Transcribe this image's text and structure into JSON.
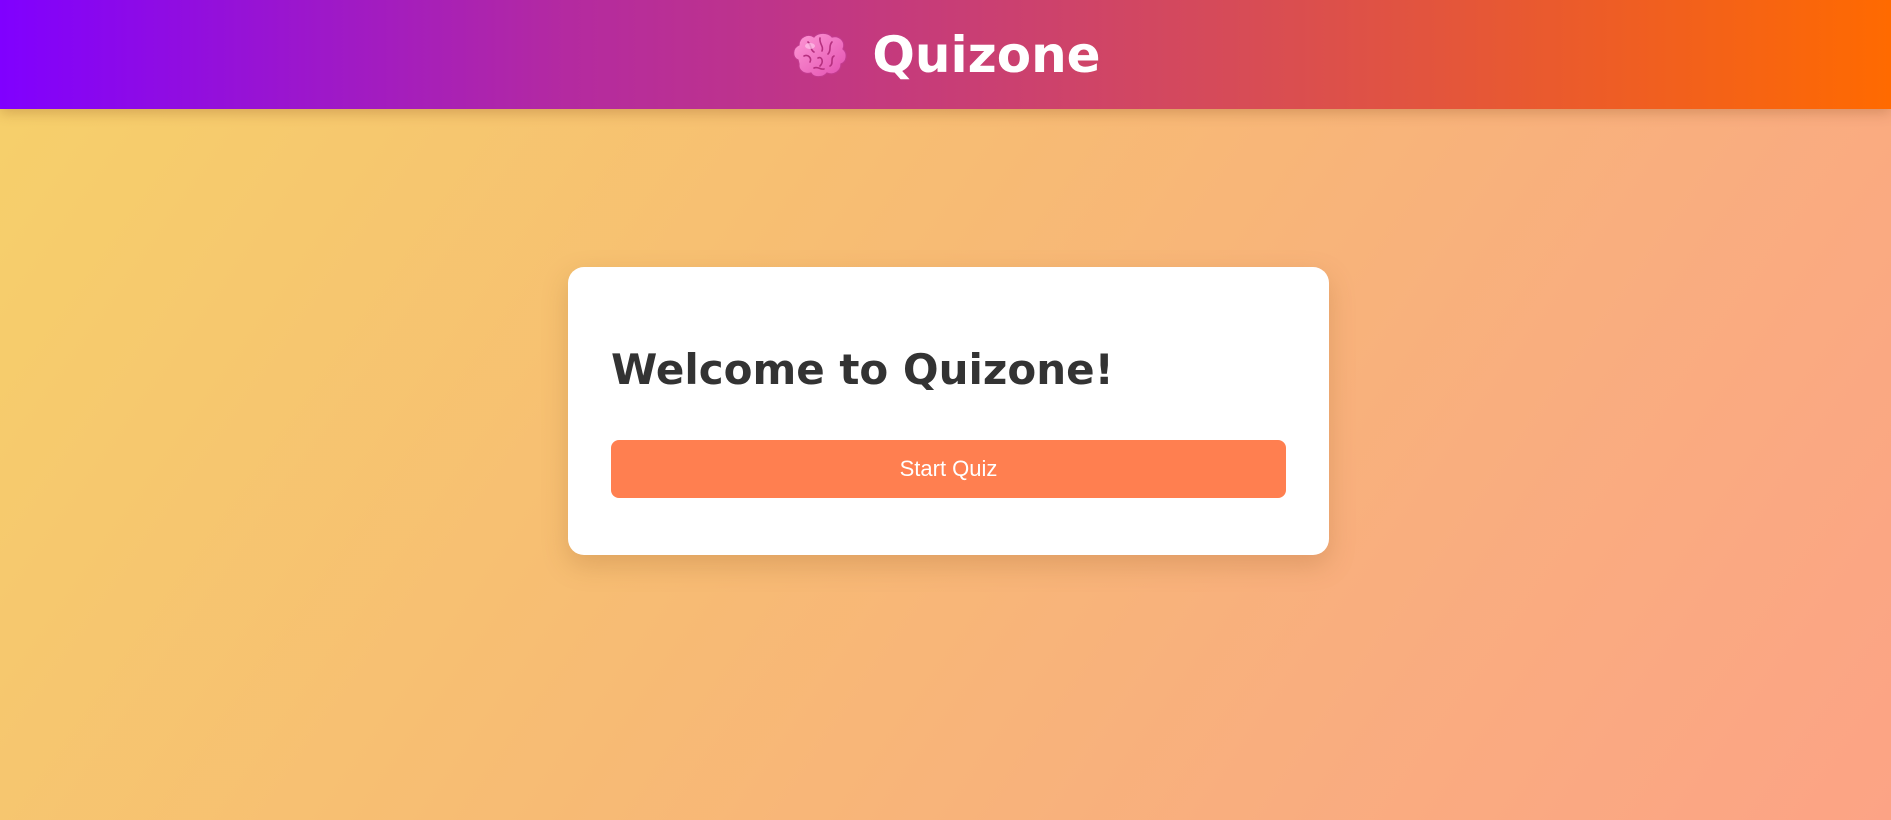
{
  "header": {
    "logo_icon": "brain-icon",
    "title": "Quizone",
    "gradient": [
      "#8000ff",
      "#ff6a00"
    ]
  },
  "welcome_card": {
    "heading": "Welcome to Quizone!",
    "start_button_label": "Start Quiz",
    "button_color": "#ff7f50"
  },
  "colors": {
    "background_start": "#f6d16a",
    "background_end": "#fca385",
    "heading_text": "#333333"
  }
}
